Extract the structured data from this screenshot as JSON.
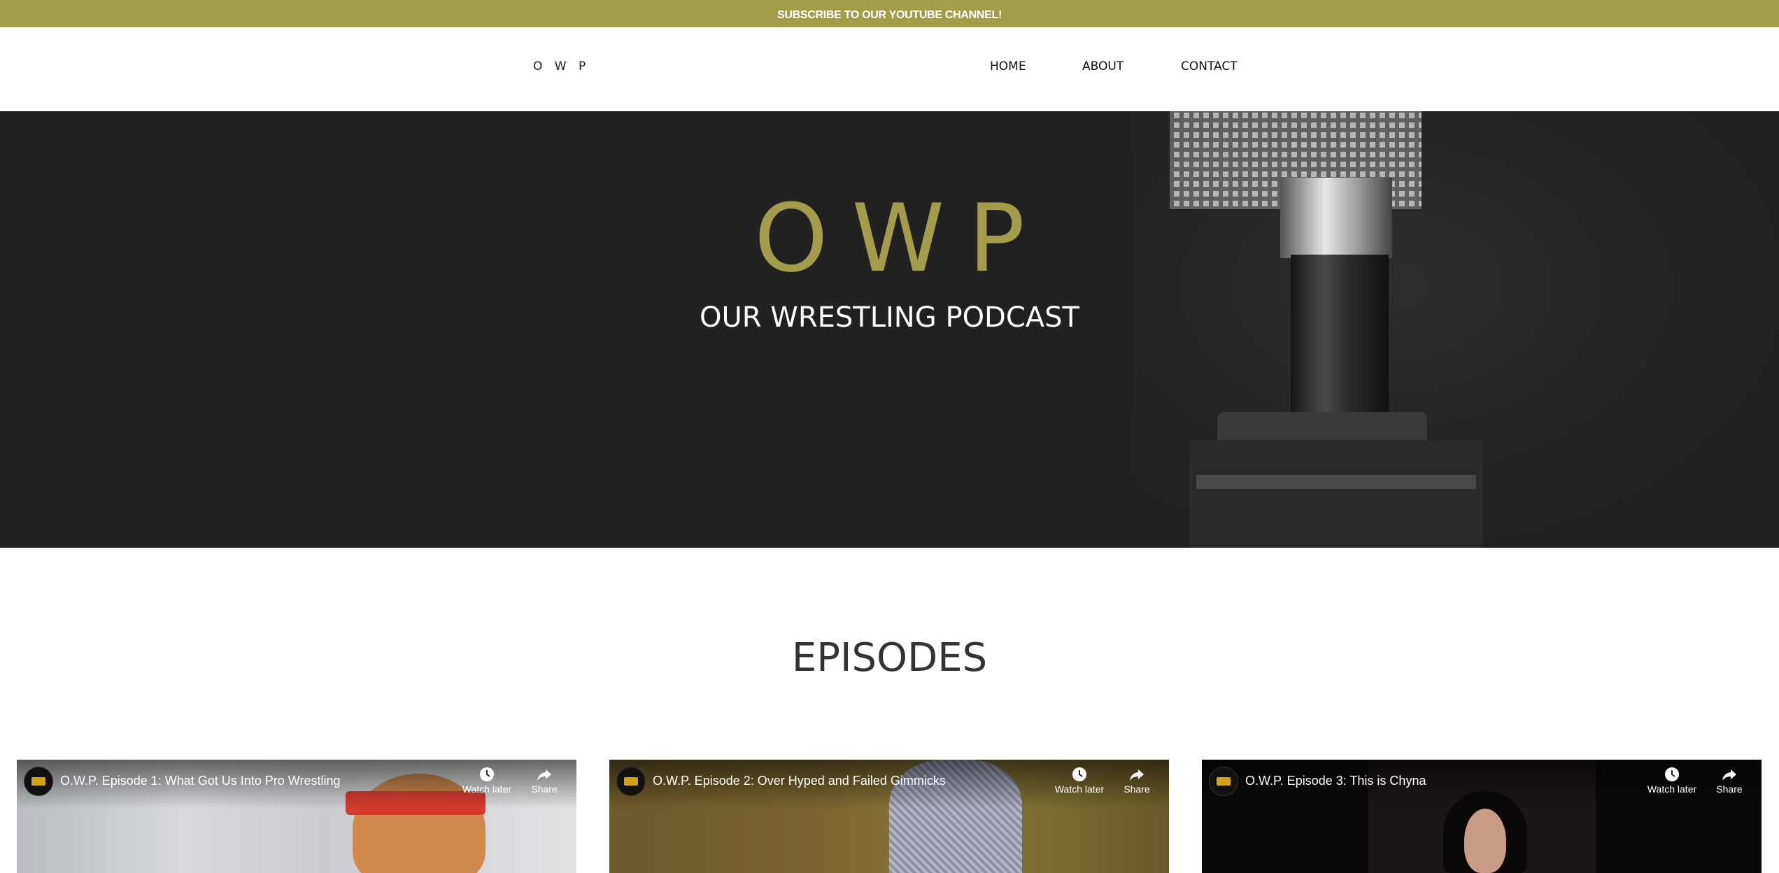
{
  "topbar": {
    "text": "SUBSCRIBE TO OUR YOUTUBE CHANNEL!"
  },
  "nav": {
    "brand": "O W P",
    "links": [
      {
        "label": "HOME"
      },
      {
        "label": "ABOUT"
      },
      {
        "label": "CONTACT"
      }
    ]
  },
  "hero": {
    "title": "OWP",
    "subtitle": "OUR WRESTLING PODCAST"
  },
  "episodes": {
    "heading": "EPISODES",
    "videos": [
      {
        "title": "O.W.P. Episode 1: What Got Us Into Pro Wrestling",
        "watch_later": "Watch later",
        "share": "Share"
      },
      {
        "title": "O.W.P. Episode 2: Over Hyped and Failed Gimmicks",
        "watch_later": "Watch later",
        "share": "Share"
      },
      {
        "title": "O.W.P. Episode 3: This is Chyna",
        "watch_later": "Watch later",
        "share": "Share"
      }
    ]
  },
  "colors": {
    "accent": "#a39d4b",
    "hero_bg": "#212121",
    "heading": "#333333"
  }
}
